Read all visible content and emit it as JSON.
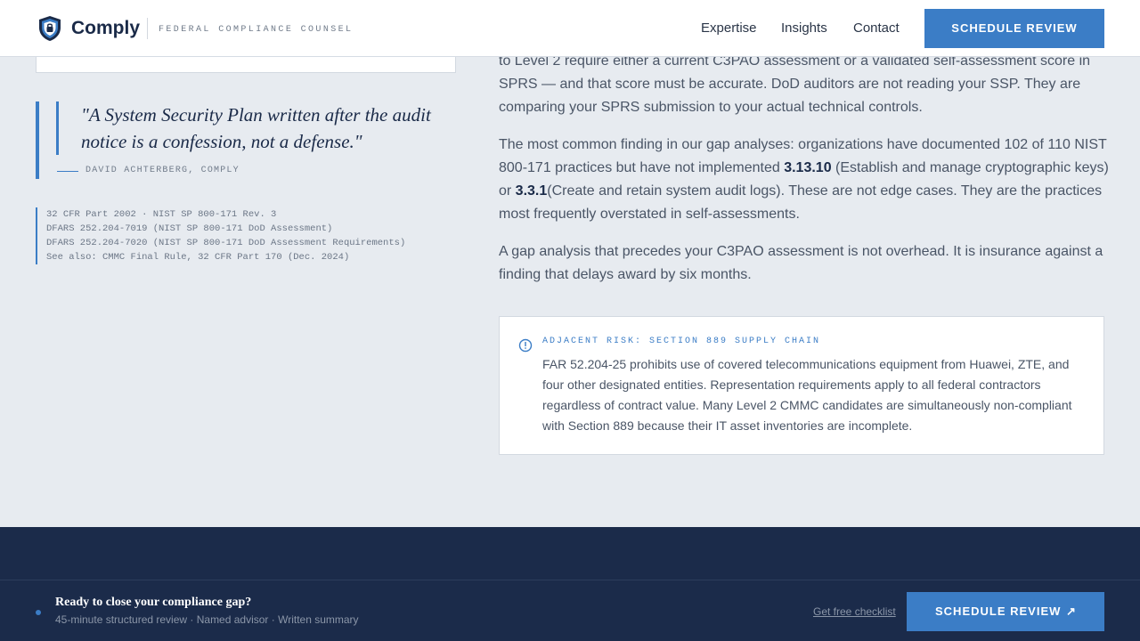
{
  "header": {
    "brand": "Comply",
    "tagline": "FEDERAL COMPLIANCE COUNSEL",
    "nav": {
      "expertise": "Expertise",
      "insights": "Insights",
      "contact": "Contact"
    },
    "cta_label": "SCHEDULE REVIEW",
    "logo_icon": "shield-lock-icon"
  },
  "sidebar": {
    "quote": "\"A System Security Plan written after the audit notice is a confession, not a defense.\"",
    "attribution": "DAVID ACHTERBERG, COMPLY",
    "citations": [
      "32 CFR Part 2002 · NIST SP 800-171 Rev. 3",
      "DFARS 252.204-7019 (NIST SP 800-171 DoD Assessment)",
      "DFARS 252.204-7020 (NIST SP 800-171 DoD Assessment Requirements)",
      "See also: CMMC Final Rule, 32 CFR Part 170 (Dec. 2024)"
    ]
  },
  "article": {
    "p1": "to Level 2 require either a current C3PAO assessment or a validated self-assessment score in SPRS — and that score must be accurate. DoD auditors are not reading your SSP. They are comparing your SPRS submission to your actual technical controls.",
    "p2_a": "The most common finding in our gap analyses: organizations have documented 102 of 110 NIST 800-171 practices but have not implemented ",
    "p2_code1": "3.13.10",
    "p2_b": " (Establish and manage cryptographic keys) or ",
    "p2_code2": "3.3.1",
    "p2_c": "(Create and retain system audit logs). These are not edge cases. They are the practices most frequently overstated in self-assessments.",
    "p3": "A gap analysis that precedes your C3PAO assessment is not overhead. It is insurance against a finding that delays award by six months."
  },
  "risk_callout": {
    "icon": "info-circle-icon",
    "title": "ADJACENT RISK: SECTION 889 SUPPLY CHAIN",
    "body": "FAR 52.204-25 prohibits use of covered telecommunications equipment from Huawei, ZTE, and four other designated entities. Representation requirements apply to all federal contractors regardless of contract value. Many Level 2 CMMC candidates are simultaneously non-compliant with Section 889 because their IT asset inventories are incomplete."
  },
  "sticky_cta": {
    "heading": "Ready to close your compliance gap?",
    "subtext": "45-minute structured review · Named advisor · Written summary",
    "secondary_link": "Get free checklist",
    "button_label": "SCHEDULE REVIEW",
    "button_arrow": "↗"
  },
  "colors": {
    "accent": "#3b7dc6",
    "navy": "#1b2b4a",
    "page_bg": "#e7ebf0"
  }
}
